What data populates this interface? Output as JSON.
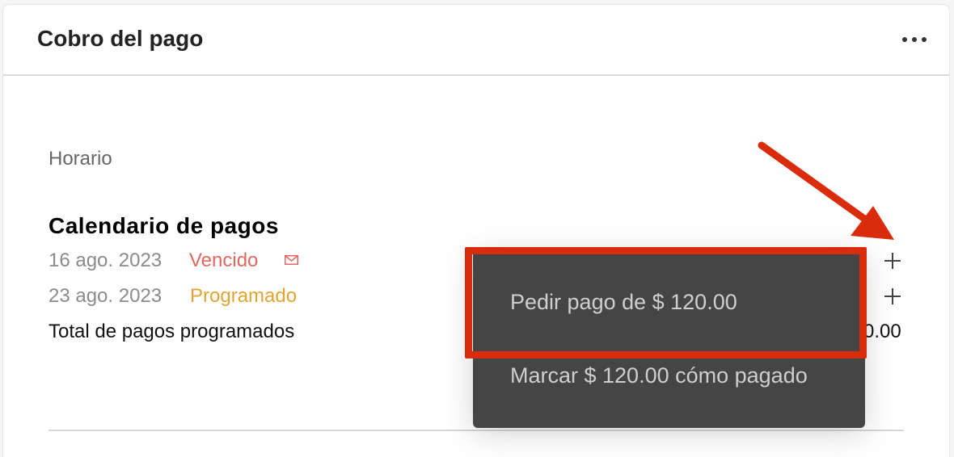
{
  "header": {
    "title": "Cobro del pago",
    "more_icon": "more-horizontal-icon"
  },
  "schedule": {
    "section_label": "Horario",
    "title": "Calendario de pagos",
    "rows": [
      {
        "date": "16 ago. 2023",
        "status": "Vencido",
        "status_color": "#e0695f",
        "icon": "mail-icon"
      },
      {
        "date": "23 ago. 2023",
        "status": "Programado",
        "status_color": "#e3a532"
      }
    ],
    "total_label": "Total de pagos programados",
    "total_value_visible": "0.00"
  },
  "menu": {
    "items": [
      {
        "label": "Pedir pago de $ 120.00",
        "highlighted": true
      },
      {
        "label": "Marcar $ 120.00 cómo pagado"
      }
    ]
  },
  "annotation": {
    "color": "#d92c0c"
  }
}
